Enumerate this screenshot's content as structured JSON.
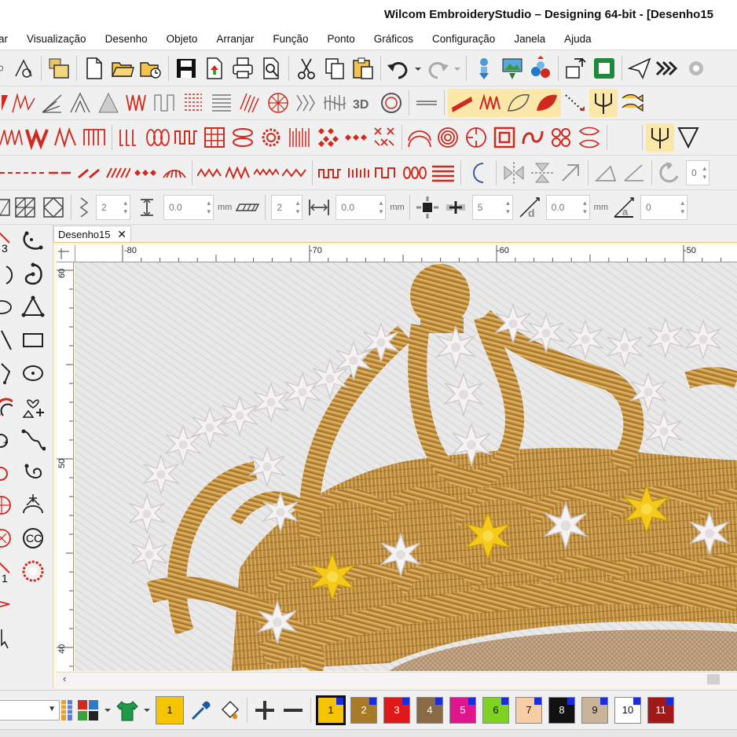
{
  "window": {
    "title": "Wilcom EmbroideryStudio – Designing 64-bit - [Desenho15"
  },
  "menu": [
    "ar",
    "Visualização",
    "Desenho",
    "Objeto",
    "Arranjar",
    "Função",
    "Ponto",
    "Gráficos",
    "Configuração",
    "Janela",
    "Ajuda"
  ],
  "toolbar5": {
    "field1": "2",
    "field2": "0.0",
    "unit1": "mm",
    "field3": "2",
    "field4": "0.0",
    "unit2": "mm",
    "field5": "5",
    "field6": "0.0",
    "unit3": "mm",
    "field7": "0",
    "label_3d": "3D"
  },
  "toolbar4": {
    "field_end": "0"
  },
  "document": {
    "tab_label": "Desenho15",
    "close_glyph": "✕"
  },
  "ruler": {
    "top_labels": [
      "-80",
      "-70",
      "-60",
      "-50"
    ],
    "left_labels": [
      "60",
      "50",
      "40"
    ]
  },
  "lefttools": {
    "label_a": "3",
    "label_b": "1"
  },
  "colorbar": {
    "current_color_label": "1",
    "current_color_hex": "#f5c400",
    "swatches": [
      {
        "label": "1",
        "color": "#f5c400",
        "text_color": "#111"
      },
      {
        "label": "2",
        "color": "#a77a28",
        "text_color": "#fff"
      },
      {
        "label": "3",
        "color": "#e01818",
        "text_color": "#fff"
      },
      {
        "label": "4",
        "color": "#8a6a45",
        "text_color": "#fff"
      },
      {
        "label": "5",
        "color": "#e0148c",
        "text_color": "#fff"
      },
      {
        "label": "6",
        "color": "#7ed321",
        "text_color": "#111"
      },
      {
        "label": "7",
        "color": "#f8cfa4",
        "text_color": "#111"
      },
      {
        "label": "8",
        "color": "#111111",
        "text_color": "#fff"
      },
      {
        "label": "9",
        "color": "#c9b49a",
        "text_color": "#111"
      },
      {
        "label": "10",
        "color": "#ffffff",
        "text_color": "#111"
      },
      {
        "label": "11",
        "color": "#a01818",
        "text_color": "#fff"
      }
    ]
  },
  "colors": {
    "accent_red": "#d0291e",
    "highlight": "#fbe7a7",
    "gold_thread": "#b8893a",
    "yellow_star": "#f2c312"
  }
}
